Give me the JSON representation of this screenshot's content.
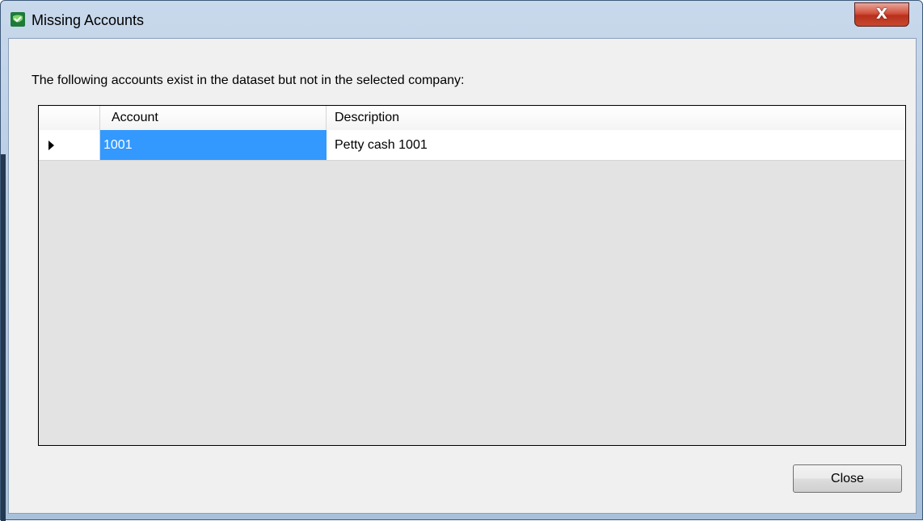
{
  "window": {
    "title": "Missing Accounts",
    "close_glyph": "X",
    "icon": "app-shield-icon"
  },
  "message": "The following accounts exist in the dataset but not in the selected company:",
  "grid": {
    "columns": [
      "Account",
      "Description"
    ],
    "rows": [
      {
        "account": "1001",
        "description": "Petty cash 1001",
        "selected": true
      }
    ],
    "selection_color": "#3399ff"
  },
  "buttons": {
    "close_label": "Close"
  }
}
